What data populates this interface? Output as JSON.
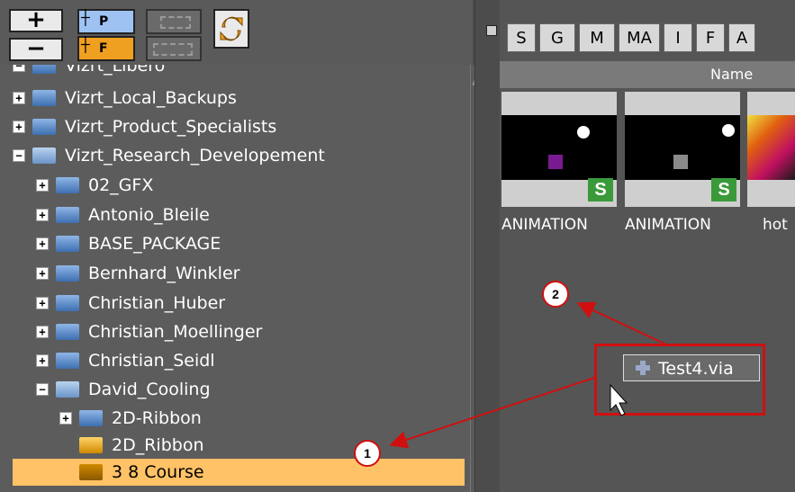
{
  "toolbar": {
    "add_label": "+",
    "remove_label": "−",
    "new_project_label": "P",
    "new_folder_label": "F"
  },
  "tree": {
    "top_partial": "Vizrt_Libero",
    "items": [
      {
        "label": "Vizrt_Local_Backups",
        "expander": "+"
      },
      {
        "label": "Vizrt_Product_Specialists",
        "expander": "+"
      },
      {
        "label": "Vizrt_Research_Developement",
        "expander": "−"
      },
      {
        "label": "02_GFX",
        "expander": "+"
      },
      {
        "label": "Antonio_Bleile",
        "expander": "+"
      },
      {
        "label": "BASE_PACKAGE",
        "expander": "+"
      },
      {
        "label": "Bernhard_Winkler",
        "expander": "+"
      },
      {
        "label": "Christian_Huber",
        "expander": "+"
      },
      {
        "label": "Christian_Moellinger",
        "expander": "+"
      },
      {
        "label": "Christian_Seidl",
        "expander": "+"
      },
      {
        "label": "David_Cooling",
        "expander": "−"
      },
      {
        "label": "2D-Ribbon",
        "expander": "+"
      },
      {
        "label": "2D_Ribbon",
        "expander": ""
      },
      {
        "label": "3 8 Course",
        "expander": ""
      }
    ]
  },
  "filter_tabs": [
    "S",
    "G",
    "M",
    "MA",
    "I",
    "F",
    "A"
  ],
  "column_header": "Name",
  "thumbnails": [
    {
      "label": "ANIMATION",
      "badge": "S"
    },
    {
      "label": "ANIMATION",
      "badge": "S"
    },
    {
      "label": "hot",
      "badge": ""
    }
  ],
  "drag_item": {
    "label": "Test4.via"
  },
  "callouts": {
    "one": "1",
    "two": "2"
  },
  "colors": {
    "accent_red": "#d01010",
    "selection": "#ffc266",
    "badge_green": "#3a9a3a"
  }
}
